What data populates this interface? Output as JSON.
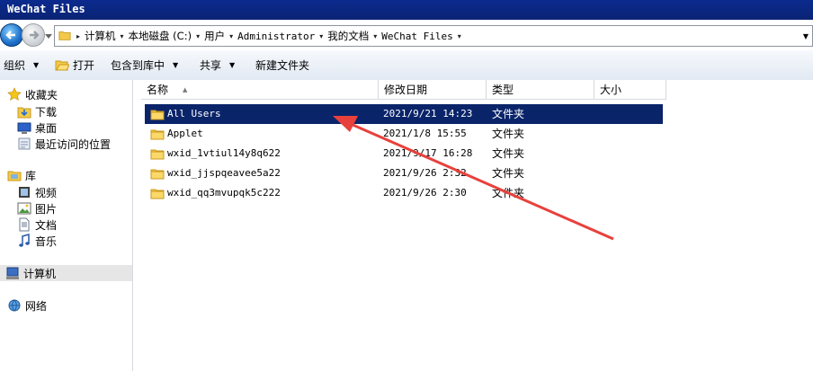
{
  "window": {
    "title": "WeChat Files"
  },
  "address": {
    "breadcrumbs": [
      {
        "label": "计算机",
        "mono": false
      },
      {
        "label": "本地磁盘 (C:)",
        "mono": false
      },
      {
        "label": "用户",
        "mono": false
      },
      {
        "label": "Administrator",
        "mono": true
      },
      {
        "label": "我的文档",
        "mono": false
      },
      {
        "label": "WeChat Files",
        "mono": true
      }
    ]
  },
  "toolbar": {
    "organize": "组织",
    "open": "打开",
    "include_in_library": "包含到库中",
    "share": "共享",
    "new_folder": "新建文件夹"
  },
  "nav": {
    "favorites": "收藏夹",
    "downloads": "下载",
    "desktop": "桌面",
    "recent": "最近访问的位置",
    "libraries": "库",
    "videos": "视频",
    "pictures": "图片",
    "documents": "文档",
    "music": "音乐",
    "computer": "计算机",
    "network": "网络"
  },
  "columns": {
    "name": "名称",
    "modified": "修改日期",
    "type": "类型",
    "size": "大小"
  },
  "files": [
    {
      "name": "All Users",
      "modified": "2021/9/21 14:23",
      "type": "文件夹",
      "selected": true
    },
    {
      "name": "Applet",
      "modified": "2021/1/8 15:55",
      "type": "文件夹",
      "selected": false
    },
    {
      "name": "wxid_1vtiul14y8q622",
      "modified": "2021/9/17 16:28",
      "type": "文件夹",
      "selected": false
    },
    {
      "name": "wxid_jjspqeavee5a22",
      "modified": "2021/9/26 2:32",
      "type": "文件夹",
      "selected": false
    },
    {
      "name": "wxid_qq3mvupqk5c222",
      "modified": "2021/9/26 2:30",
      "type": "文件夹",
      "selected": false
    }
  ],
  "colors": {
    "title_bar": "#0a2474",
    "selection": "#0a246a",
    "annotation_arrow": "#e8413c"
  }
}
